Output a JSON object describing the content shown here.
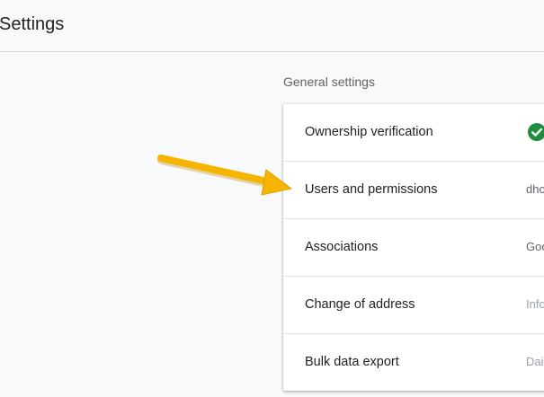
{
  "header": {
    "title": "Settings"
  },
  "general_settings": {
    "title": "General settings",
    "items": [
      {
        "label": "Ownership verification",
        "value": "",
        "status_icon": "check-circle-icon",
        "status_color": "#1e8e3e"
      },
      {
        "label": "Users and permissions",
        "value": "dhc"
      },
      {
        "label": "Associations",
        "value": "Goo"
      },
      {
        "label": "Change of address",
        "value": "Info"
      },
      {
        "label": "Bulk data export",
        "value": "Dai"
      }
    ]
  },
  "annotation": {
    "icon": "arrow-annotation-icon",
    "color": "#f4b400",
    "points_to": "Users and permissions"
  }
}
